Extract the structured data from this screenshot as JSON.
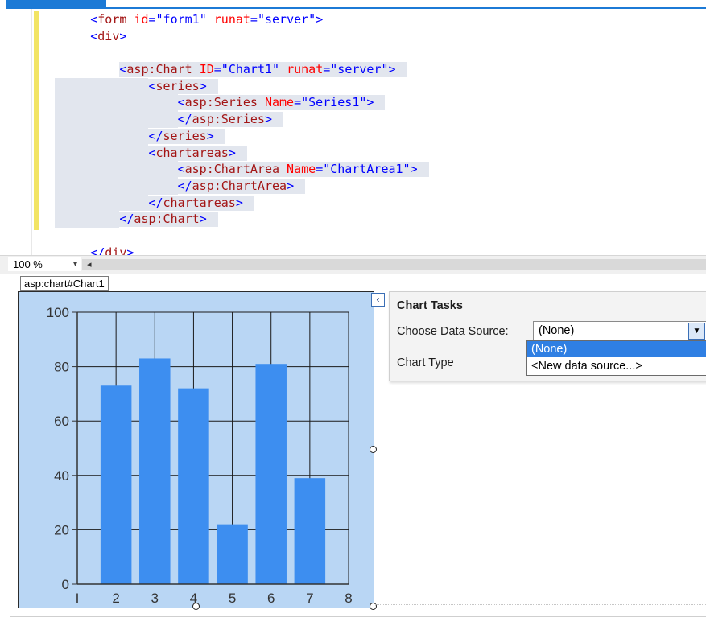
{
  "editor": {
    "lines": [
      {
        "indent": "        ",
        "parts": [
          {
            "t": "<",
            "c": "brk"
          },
          {
            "t": "form",
            "c": "tag"
          },
          {
            "t": " id",
            "c": "attr"
          },
          {
            "t": "=",
            "c": "brk"
          },
          {
            "t": "\"form1\"",
            "c": "aval"
          },
          {
            "t": " runat",
            "c": "attr"
          },
          {
            "t": "=",
            "c": "brk"
          },
          {
            "t": "\"server\"",
            "c": "aval"
          },
          {
            "t": ">",
            "c": "brk"
          }
        ]
      },
      {
        "indent": "        ",
        "parts": [
          {
            "t": "<",
            "c": "brk"
          },
          {
            "t": "div",
            "c": "tag"
          },
          {
            "t": ">",
            "c": "brk"
          }
        ]
      },
      {
        "indent": "",
        "parts": []
      },
      {
        "indent": "            ",
        "parts": [
          {
            "t": "<",
            "c": "brk"
          },
          {
            "t": "asp:Chart",
            "c": "tag"
          },
          {
            "t": " ID",
            "c": "attr"
          },
          {
            "t": "=",
            "c": "brk"
          },
          {
            "t": "\"Chart1\"",
            "c": "aval"
          },
          {
            "t": " runat",
            "c": "attr"
          },
          {
            "t": "=",
            "c": "brk"
          },
          {
            "t": "\"server\"",
            "c": "aval"
          },
          {
            "t": ">",
            "c": "brk"
          }
        ]
      },
      {
        "indent": "                ",
        "parts": [
          {
            "t": "<",
            "c": "brk"
          },
          {
            "t": "series",
            "c": "tag"
          },
          {
            "t": ">",
            "c": "brk"
          }
        ]
      },
      {
        "indent": "                    ",
        "parts": [
          {
            "t": "<",
            "c": "brk"
          },
          {
            "t": "asp:Series",
            "c": "tag"
          },
          {
            "t": " Name",
            "c": "attr"
          },
          {
            "t": "=",
            "c": "brk"
          },
          {
            "t": "\"Series1\"",
            "c": "aval"
          },
          {
            "t": ">",
            "c": "brk"
          }
        ]
      },
      {
        "indent": "                    ",
        "parts": [
          {
            "t": "</",
            "c": "brk"
          },
          {
            "t": "asp:Series",
            "c": "tag"
          },
          {
            "t": ">",
            "c": "brk"
          }
        ]
      },
      {
        "indent": "                ",
        "parts": [
          {
            "t": "</",
            "c": "brk"
          },
          {
            "t": "series",
            "c": "tag"
          },
          {
            "t": ">",
            "c": "brk"
          }
        ]
      },
      {
        "indent": "                ",
        "parts": [
          {
            "t": "<",
            "c": "brk"
          },
          {
            "t": "chartareas",
            "c": "tag"
          },
          {
            "t": ">",
            "c": "brk"
          }
        ]
      },
      {
        "indent": "                    ",
        "parts": [
          {
            "t": "<",
            "c": "brk"
          },
          {
            "t": "asp:ChartArea",
            "c": "tag"
          },
          {
            "t": " Name",
            "c": "attr"
          },
          {
            "t": "=",
            "c": "brk"
          },
          {
            "t": "\"ChartArea1\"",
            "c": "aval"
          },
          {
            "t": ">",
            "c": "brk"
          }
        ]
      },
      {
        "indent": "                    ",
        "parts": [
          {
            "t": "</",
            "c": "brk"
          },
          {
            "t": "asp:ChartArea",
            "c": "tag"
          },
          {
            "t": ">",
            "c": "brk"
          }
        ]
      },
      {
        "indent": "                ",
        "parts": [
          {
            "t": "</",
            "c": "brk"
          },
          {
            "t": "chartareas",
            "c": "tag"
          },
          {
            "t": ">",
            "c": "brk"
          }
        ]
      },
      {
        "indent": "            ",
        "parts": [
          {
            "t": "</",
            "c": "brk"
          },
          {
            "t": "asp:Chart",
            "c": "tag"
          },
          {
            "t": ">",
            "c": "brk"
          }
        ]
      },
      {
        "indent": "",
        "parts": []
      },
      {
        "indent": "        ",
        "parts": [
          {
            "t": "</",
            "c": "brk"
          },
          {
            "t": "div",
            "c": "tag"
          },
          {
            "t": ">",
            "c": "brk"
          }
        ]
      }
    ],
    "highlighted_lines": [
      3,
      4,
      5,
      6,
      7,
      8,
      9,
      10,
      11,
      12
    ]
  },
  "zoom": {
    "value": "100 %",
    "dropdown_icon": "chevron-down-icon"
  },
  "design": {
    "control_tab": "asp:chart#Chart1"
  },
  "chart_tasks": {
    "title": "Chart Tasks",
    "data_source_label": "Choose Data Source:",
    "data_source_value": "(None)",
    "chart_type_label": "Chart Type",
    "options": [
      "(None)",
      "<New data source...>"
    ],
    "selected_option": "(None)"
  },
  "colors": {
    "bar": "#3d8ef0",
    "plot_bg": "#b9d6f4",
    "grid": "#1a1a1a",
    "selected": "#2f7fe3"
  },
  "chart_data": {
    "type": "bar",
    "x": [
      2,
      3,
      4,
      5,
      6,
      7
    ],
    "values": [
      73,
      83,
      72,
      22,
      81,
      39
    ],
    "x_tick_labels": [
      "I",
      "2",
      "3",
      "4",
      "5",
      "6",
      "7",
      "8"
    ],
    "y_tick_labels": [
      "0",
      "20",
      "40",
      "60",
      "80",
      "100"
    ],
    "xlim": [
      1,
      8
    ],
    "ylim": [
      0,
      100
    ],
    "grid": true
  }
}
